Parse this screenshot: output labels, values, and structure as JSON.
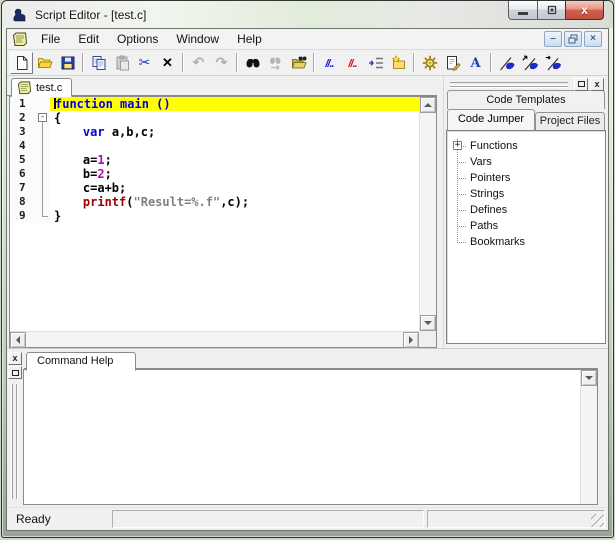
{
  "window": {
    "title": "Script Editor - [test.c]",
    "buttons": [
      "minimize",
      "maximize",
      "close"
    ],
    "close_glyph": "x"
  },
  "menu": {
    "items": [
      "File",
      "Edit",
      "Options",
      "Window",
      "Help"
    ],
    "mdi_buttons": [
      "minimize",
      "restore",
      "close"
    ]
  },
  "toolbar": {
    "groups": [
      {
        "buttons": [
          {
            "icon": "new-file",
            "hot": true
          },
          {
            "icon": "open-file"
          },
          {
            "icon": "save-file"
          }
        ]
      },
      {
        "buttons": [
          {
            "icon": "copy"
          },
          {
            "icon": "paste",
            "disabled": true
          },
          {
            "icon": "cut"
          },
          {
            "icon": "delete"
          }
        ]
      },
      {
        "buttons": [
          {
            "icon": "undo",
            "disabled": true
          },
          {
            "icon": "redo",
            "disabled": true
          }
        ]
      },
      {
        "buttons": [
          {
            "icon": "find"
          },
          {
            "icon": "find-next",
            "disabled": true
          },
          {
            "icon": "find-in-files"
          }
        ]
      },
      {
        "buttons": [
          {
            "icon": "comment"
          },
          {
            "icon": "uncomment"
          },
          {
            "icon": "indent"
          },
          {
            "icon": "insert-template"
          }
        ]
      },
      {
        "buttons": [
          {
            "icon": "settings"
          },
          {
            "icon": "properties"
          },
          {
            "icon": "font"
          }
        ]
      },
      {
        "buttons": [
          {
            "icon": "run"
          },
          {
            "icon": "run-marked"
          },
          {
            "icon": "run-step"
          }
        ]
      }
    ],
    "comment_glyph": "//..",
    "font_glyph": "A"
  },
  "editor": {
    "tab_label": "test.c",
    "lines": [
      {
        "n": "1",
        "fold": "",
        "hl": true,
        "seg": [
          [
            "kw",
            "function main ()"
          ]
        ]
      },
      {
        "n": "2",
        "fold": "minus",
        "hl": false,
        "seg": [
          [
            "p",
            "{"
          ]
        ]
      },
      {
        "n": "3",
        "fold": "line",
        "hl": false,
        "seg": [
          [
            "p",
            "    "
          ],
          [
            "kw",
            "var"
          ],
          [
            "p",
            " a,b,c;"
          ]
        ]
      },
      {
        "n": "4",
        "fold": "line",
        "hl": false,
        "seg": []
      },
      {
        "n": "5",
        "fold": "line",
        "hl": false,
        "seg": [
          [
            "p",
            "    a="
          ],
          [
            "num",
            "1"
          ],
          [
            "p",
            ";"
          ]
        ]
      },
      {
        "n": "6",
        "fold": "line",
        "hl": false,
        "seg": [
          [
            "p",
            "    b="
          ],
          [
            "num",
            "2"
          ],
          [
            "p",
            ";"
          ]
        ]
      },
      {
        "n": "7",
        "fold": "line",
        "hl": false,
        "seg": [
          [
            "p",
            "    c=a+b;"
          ]
        ]
      },
      {
        "n": "8",
        "fold": "line",
        "hl": false,
        "seg": [
          [
            "p",
            "    "
          ],
          [
            "fn",
            "printf"
          ],
          [
            "p",
            "("
          ],
          [
            "str",
            "\"Result=%.f\""
          ],
          [
            "p",
            ",c);"
          ]
        ]
      },
      {
        "n": "9",
        "fold": "end",
        "hl": false,
        "seg": [
          [
            "p",
            "}"
          ]
        ]
      }
    ],
    "fold_collapse_glyph": "-",
    "tree_expand_glyph": "+"
  },
  "right_panel": {
    "tabs": [
      "Code Templates",
      "Code Jumper",
      "Project Files"
    ],
    "active_tab": "Code Jumper",
    "header_buttons": [
      "maximize",
      "close"
    ],
    "tree": [
      {
        "label": "Functions",
        "expandable": true
      },
      {
        "label": "Vars"
      },
      {
        "label": "Pointers"
      },
      {
        "label": "Strings"
      },
      {
        "label": "Defines"
      },
      {
        "label": "Paths"
      },
      {
        "label": "Bookmarks"
      }
    ]
  },
  "bottom_panel": {
    "tab": "Command Help",
    "strip_buttons": [
      "close",
      "maximize"
    ]
  },
  "status": {
    "text": "Ready",
    "panels": [
      "",
      ""
    ]
  },
  "colors": {
    "highlight": "#ffff00",
    "keyword": "#0000dd",
    "number": "#c000c0",
    "function": "#990000",
    "string": "#808080",
    "close_button": "#c14f40",
    "selection_titlebar": "#e2ecdb"
  }
}
